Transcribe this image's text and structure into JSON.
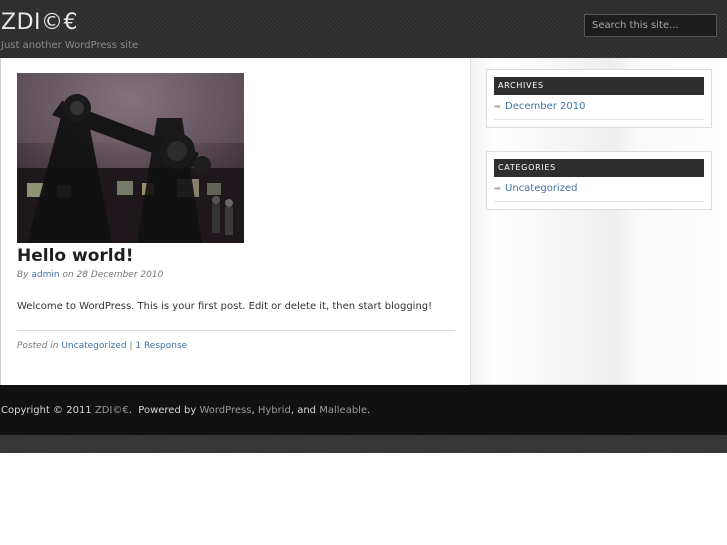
{
  "header": {
    "site_title": "ZDI©€",
    "site_description": "Just another WordPress site",
    "search_placeholder": "Search this site..."
  },
  "post": {
    "title": "Hello world!",
    "byline_prefix": "By",
    "author": "admin",
    "date_prefix": "on",
    "date": "28 December 2010",
    "body": "Welcome to WordPress. This is your first post. Edit or delete it, then start blogging!",
    "posted_in_label": "Posted in",
    "category": "Uncategorized",
    "separator": "|",
    "responses": "1 Response"
  },
  "sidebar": {
    "archives": {
      "title": "ARCHIVES",
      "items": [
        "December 2010"
      ]
    },
    "categories": {
      "title": "CATEGORIES",
      "items": [
        "Uncategorized"
      ]
    }
  },
  "footer": {
    "copyright": "Copyright © 2011",
    "site_link": "ZDI©€",
    "powered_by": "Powered by",
    "wordpress": "WordPress",
    "hybrid": "Hybrid",
    "and": "and",
    "malleable": "Malleable"
  },
  "colors": {
    "link": "#3f73a6",
    "header_bg": "#2f2f2f",
    "footer_bg": "#111111",
    "widget_title_bg": "#2e2e2e"
  },
  "icons": {
    "list_bullet": "arrow-bullet-icon",
    "thumbnail": "planetarium-projector-image"
  }
}
